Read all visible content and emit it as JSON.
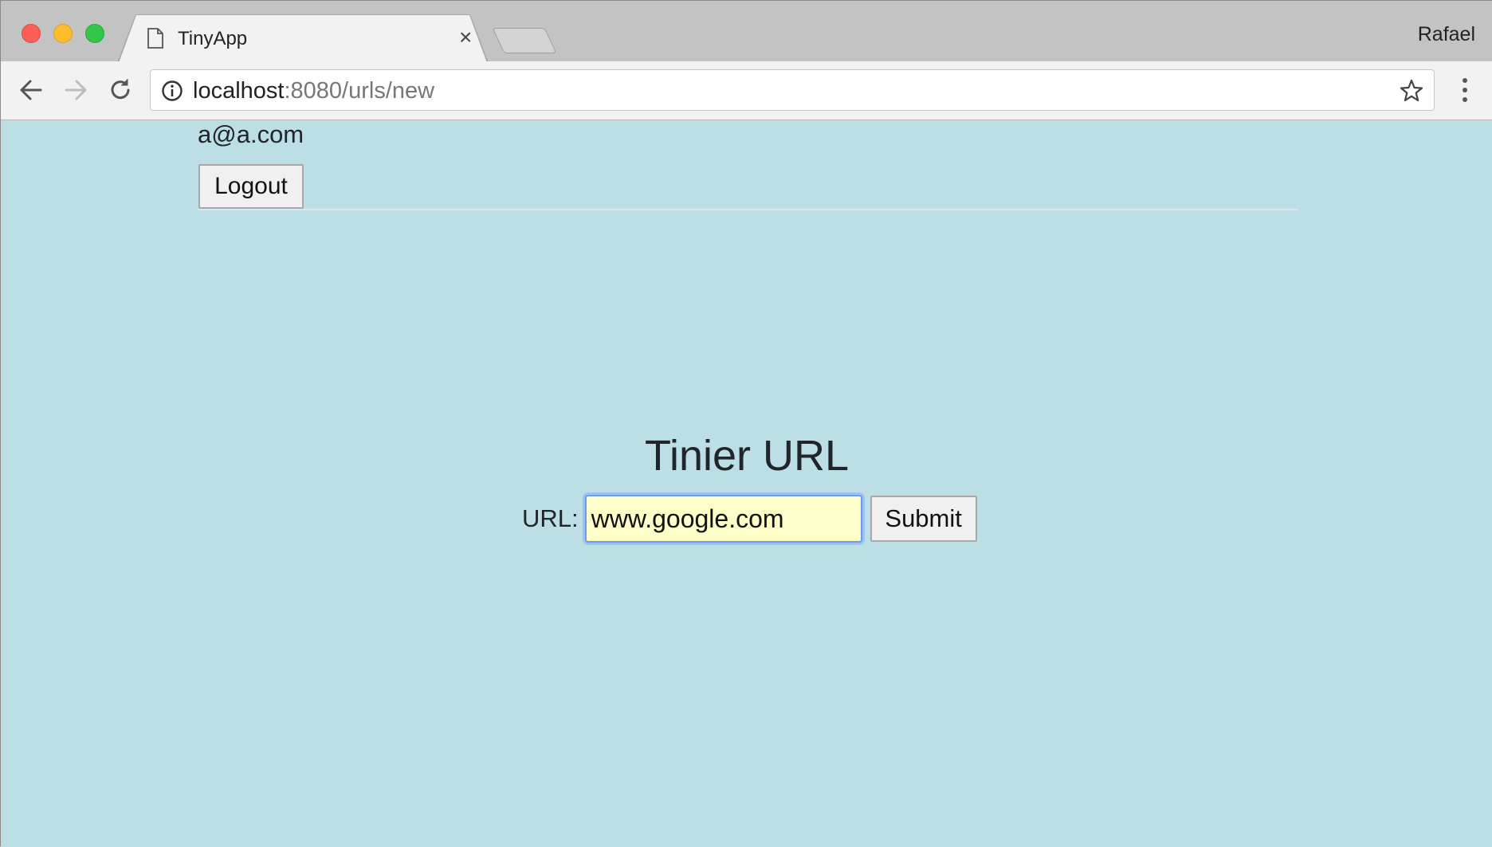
{
  "browser": {
    "tab_title": "TinyApp",
    "tab_close": "×",
    "profile_name": "Rafael",
    "url_host": "localhost",
    "url_rest": ":8080/urls/new"
  },
  "header": {
    "user_email": "a@a.com",
    "logout_label": "Logout"
  },
  "main": {
    "title": "Tinier URL",
    "url_label": "URL:",
    "url_value": "www.google.com",
    "submit_label": "Submit"
  },
  "icons": {
    "tab": "page-icon",
    "back": "arrow-left-icon",
    "forward": "arrow-right-icon",
    "reload": "reload-icon",
    "info": "info-icon",
    "bookmark": "star-icon",
    "menu": "kebab-menu-icon"
  },
  "colors": {
    "page_background": "#bbdfe4",
    "input_background": "#fefec8",
    "focus_ring": "#6a9ee8"
  }
}
